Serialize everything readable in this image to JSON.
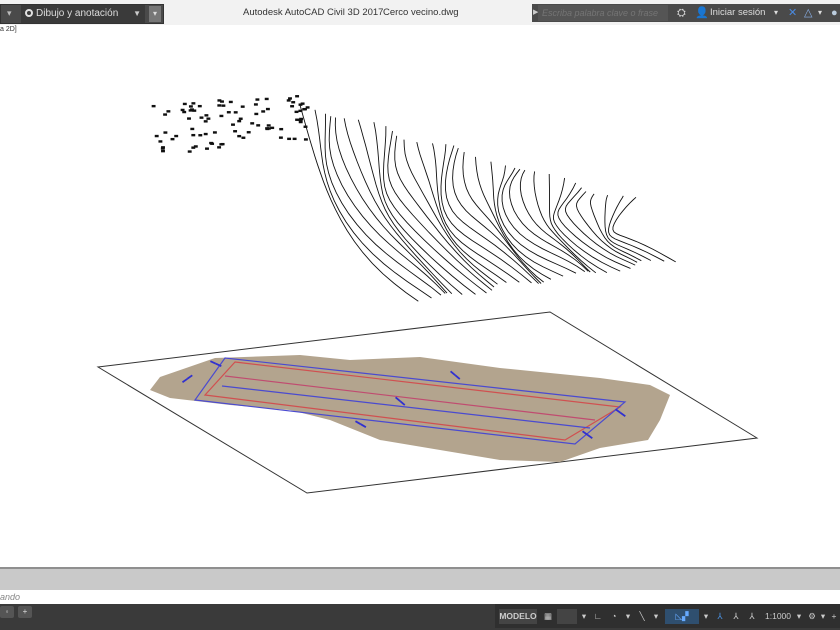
{
  "titlebar": {
    "workspace": "Dibujo y anotación",
    "app_title": "Autodesk AutoCAD Civil 3D 2017",
    "file_name": "Cerco vecino.dwg",
    "search_placeholder": "Escriba palabra clave o frase",
    "login_label": "Iniciar sesión"
  },
  "viewport": {
    "label": "a 2D]"
  },
  "command": {
    "prompt": "ando"
  },
  "layout_tabs": [
    "◦",
    "+"
  ],
  "status": {
    "model_label": "MODELO",
    "scale": "1:1000"
  },
  "colors": {
    "surface": "#b3a48e",
    "boundary_red": "#d05050",
    "boundary_blue": "#4a4ad0",
    "label_blue": "#3030d0"
  }
}
